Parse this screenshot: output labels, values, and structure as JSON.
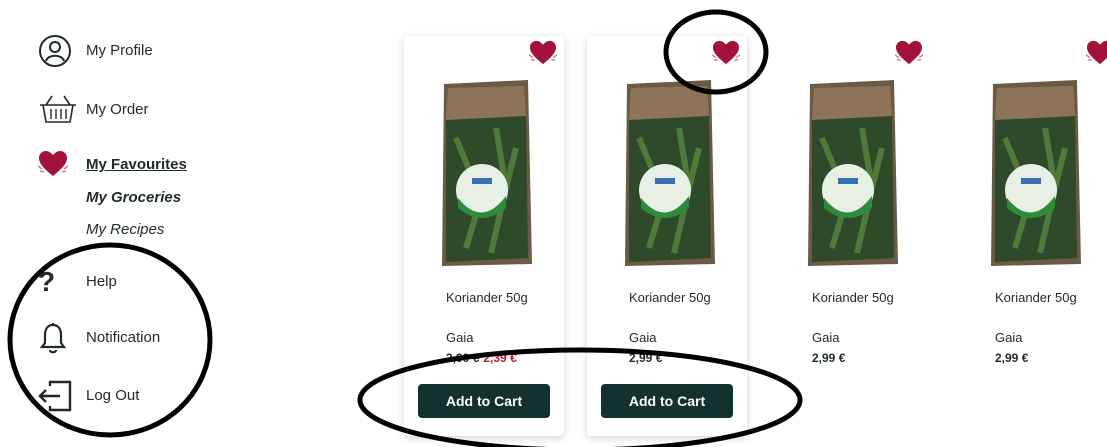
{
  "sidebar": {
    "profile_label": "My Profile",
    "order_label": "My Order",
    "favourites_label": "My Favourites",
    "groceries_label": "My Groceries",
    "recipes_label": "My Recipes",
    "help_label": "Help",
    "notification_label": "Notification",
    "logout_label": "Log Out"
  },
  "colors": {
    "brand_dark": "#12312f",
    "heart": "#a3123a",
    "sale": "#c0142a"
  },
  "products": [
    {
      "name": "Koriander 50g",
      "brand": "Gaia",
      "price": "2,99 €",
      "sale_price": "2,39 €",
      "button": "Add to Cart"
    },
    {
      "name": "Koriander 50g",
      "brand": "Gaia",
      "price": "2,99 €",
      "button": "Add to Cart"
    },
    {
      "name": "Koriander 50g",
      "brand": "Gaia",
      "price": "2,99 €"
    },
    {
      "name": "Koriander 50g",
      "brand": "Gaia",
      "price": "2,99 €"
    }
  ]
}
